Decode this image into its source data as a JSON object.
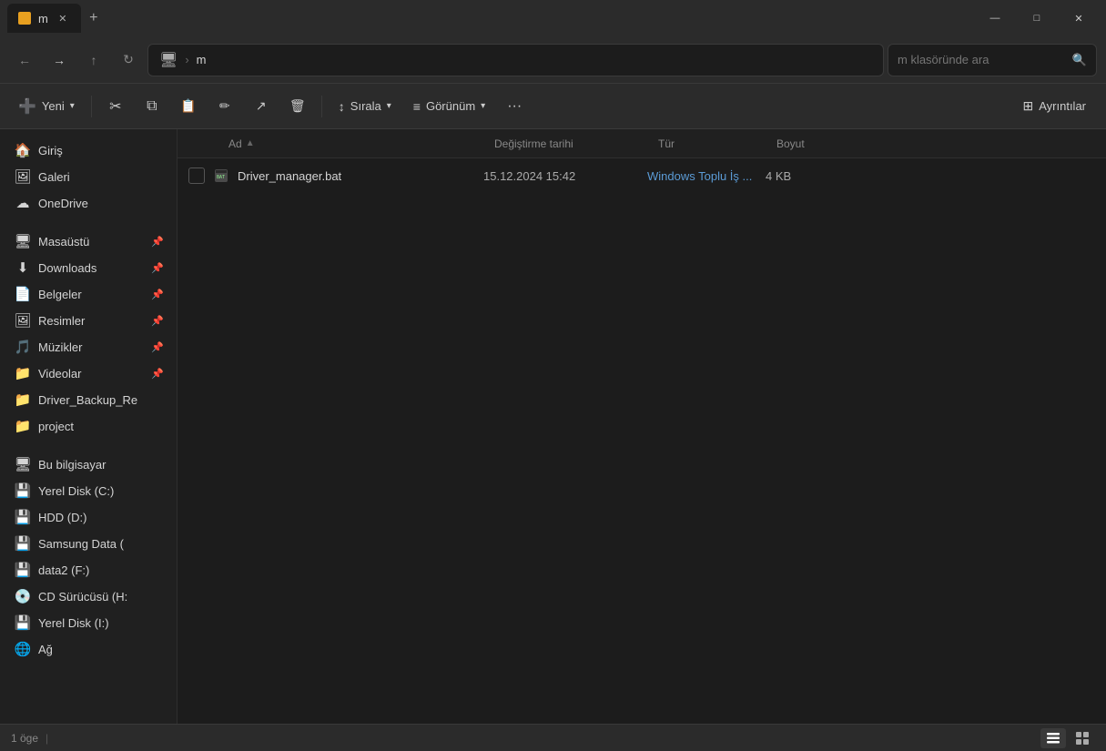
{
  "window": {
    "title": "m",
    "tab_label": "m",
    "tab_icon_color": "#e8a020"
  },
  "titlebar": {
    "minimize": "—",
    "maximize": "□",
    "close": "✕"
  },
  "navbar": {
    "back": "←",
    "forward": "→",
    "up": "↑",
    "refresh": "↻",
    "monitor_icon": "🖥",
    "separator": ">",
    "path": "m",
    "search_placeholder": "m klasöründe ara"
  },
  "toolbar": {
    "new_label": "Yeni",
    "cut_icon": "✂",
    "copy_icon": "⧉",
    "paste_icon": "📋",
    "rename_icon": "✏",
    "share_icon": "↗",
    "delete_icon": "🗑",
    "sort_label": "Sırala",
    "view_label": "Görünüm",
    "more_label": "···",
    "details_label": "Ayrıntılar"
  },
  "sidebar": {
    "items": [
      {
        "id": "giris",
        "label": "Giriş",
        "icon": "🏠",
        "pinned": false,
        "active": false
      },
      {
        "id": "galeri",
        "label": "Galeri",
        "icon": "🖼",
        "pinned": false,
        "active": false
      },
      {
        "id": "onedrive",
        "label": "OneDrive",
        "icon": "☁",
        "pinned": false,
        "active": false
      },
      {
        "id": "masaustu",
        "label": "Masaüstü",
        "icon": "🖥",
        "pinned": true,
        "active": false
      },
      {
        "id": "downloads",
        "label": "Downloads",
        "icon": "⬇",
        "pinned": true,
        "active": false
      },
      {
        "id": "belgeler",
        "label": "Belgeler",
        "icon": "📄",
        "pinned": true,
        "active": false
      },
      {
        "id": "resimler",
        "label": "Resimler",
        "icon": "🖼",
        "pinned": true,
        "active": false
      },
      {
        "id": "muzikler",
        "label": "Müzikler",
        "icon": "🎵",
        "pinned": true,
        "active": false
      },
      {
        "id": "videolar",
        "label": "Videolar",
        "icon": "📁",
        "pinned": true,
        "active": false
      },
      {
        "id": "driver-backup",
        "label": "Driver_Backup_Re",
        "icon": "📁",
        "pinned": false,
        "active": false
      },
      {
        "id": "project",
        "label": "project",
        "icon": "📁",
        "pinned": false,
        "active": false
      }
    ],
    "drives": [
      {
        "id": "this-pc",
        "label": "Bu bilgisayar",
        "icon": "🖥"
      },
      {
        "id": "local-c",
        "label": "Yerel Disk (C:)",
        "icon": "💾"
      },
      {
        "id": "hdd-d",
        "label": "HDD (D:)",
        "icon": "💾"
      },
      {
        "id": "samsung",
        "label": "Samsung Data (",
        "icon": "💾"
      },
      {
        "id": "data2",
        "label": "data2 (F:)",
        "icon": "💾"
      },
      {
        "id": "cd-drive",
        "label": "CD Sürücüsü (H:",
        "icon": "💿"
      },
      {
        "id": "local-i",
        "label": "Yerel Disk (I:)",
        "icon": "💾"
      },
      {
        "id": "ag",
        "label": "Ağ",
        "icon": "🌐"
      }
    ]
  },
  "file_list": {
    "columns": {
      "name": "Ad",
      "date": "Değiştirme tarihi",
      "type": "Tür",
      "size": "Boyut"
    },
    "files": [
      {
        "name": "Driver_manager.bat",
        "date": "15.12.2024 15:42",
        "type": "Windows Toplu İş ...",
        "size": "4 KB",
        "icon": "bat"
      }
    ]
  },
  "statusbar": {
    "count": "1 öge",
    "sep": "|"
  }
}
